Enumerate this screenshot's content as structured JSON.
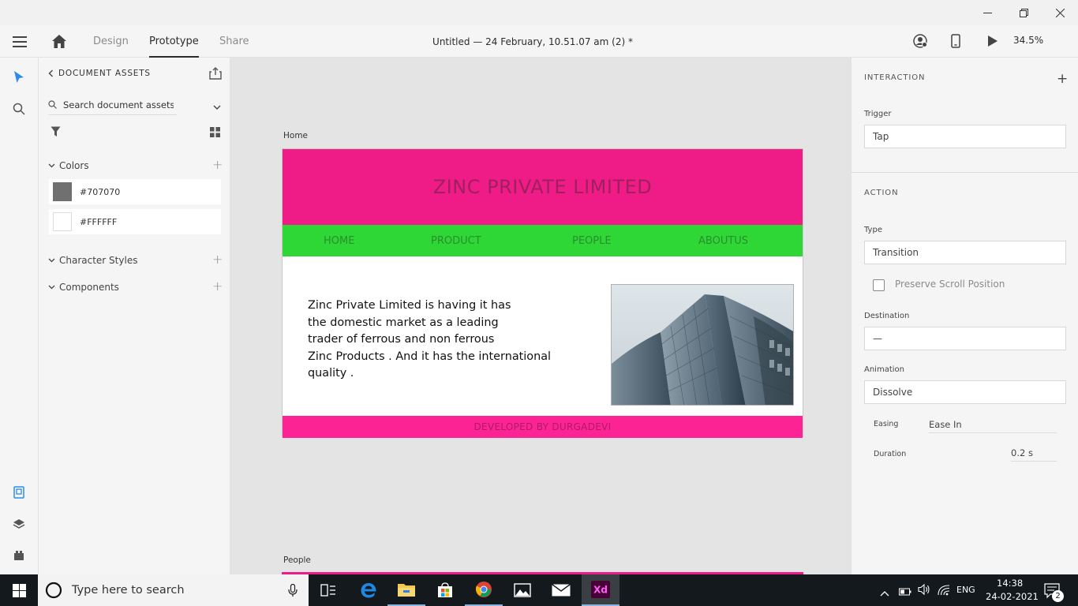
{
  "window": {
    "minimize_icon": "minimize-icon",
    "restore_icon": "restore-icon",
    "close_icon": "close-icon"
  },
  "toolbar": {
    "tabs": [
      {
        "label": "Design",
        "active": false
      },
      {
        "label": "Prototype",
        "active": true
      },
      {
        "label": "Share",
        "active": false
      }
    ],
    "doc_title": "Untitled — 24 February, 10.51.07 am (2) *",
    "zoom": "34.5%"
  },
  "assets": {
    "header": "DOCUMENT ASSETS",
    "search_placeholder": "Search document assets",
    "sections": {
      "colors": "Colors",
      "character_styles": "Character Styles",
      "components": "Components"
    },
    "colors": [
      {
        "label": "#707070",
        "hex": "#707070"
      },
      {
        "label": "#FFFFFF",
        "hex": "#FFFFFF"
      }
    ]
  },
  "canvas": {
    "artboards": [
      {
        "label": "Home",
        "hero_title": "ZINC PRIVATE LIMITED",
        "nav": [
          "HOME",
          "PRODUCT",
          "PEOPLE",
          "ABOUTUS"
        ],
        "body_lines": [
          "Zinc Private Limited is having it has",
          "the domestic market as a leading",
          "trader of ferrous and non ferrous",
          "Zinc Products . And it has the international",
          "quality ."
        ],
        "footer": "DEVELOPED BY DURGADEVI",
        "colors": {
          "hero": "#ef1b86",
          "nav": "#2fd736",
          "footer": "#fc2494"
        }
      },
      {
        "label": "People"
      }
    ]
  },
  "inspector": {
    "interaction_title": "INTERACTION",
    "trigger_label": "Trigger",
    "trigger_value": "Tap",
    "action_title": "ACTION",
    "type_label": "Type",
    "type_value": "Transition",
    "preserve_label": "Preserve Scroll Position",
    "preserve_checked": false,
    "destination_label": "Destination",
    "destination_value": "—",
    "animation_label": "Animation",
    "animation_value": "Dissolve",
    "easing_label": "Easing",
    "easing_value": "Ease In",
    "duration_label": "Duration",
    "duration_value": "0.2 s"
  },
  "taskbar": {
    "search_placeholder": "Type here to search",
    "language": "ENG",
    "time": "14:38",
    "date": "24-02-2021",
    "notification_count": "2"
  }
}
